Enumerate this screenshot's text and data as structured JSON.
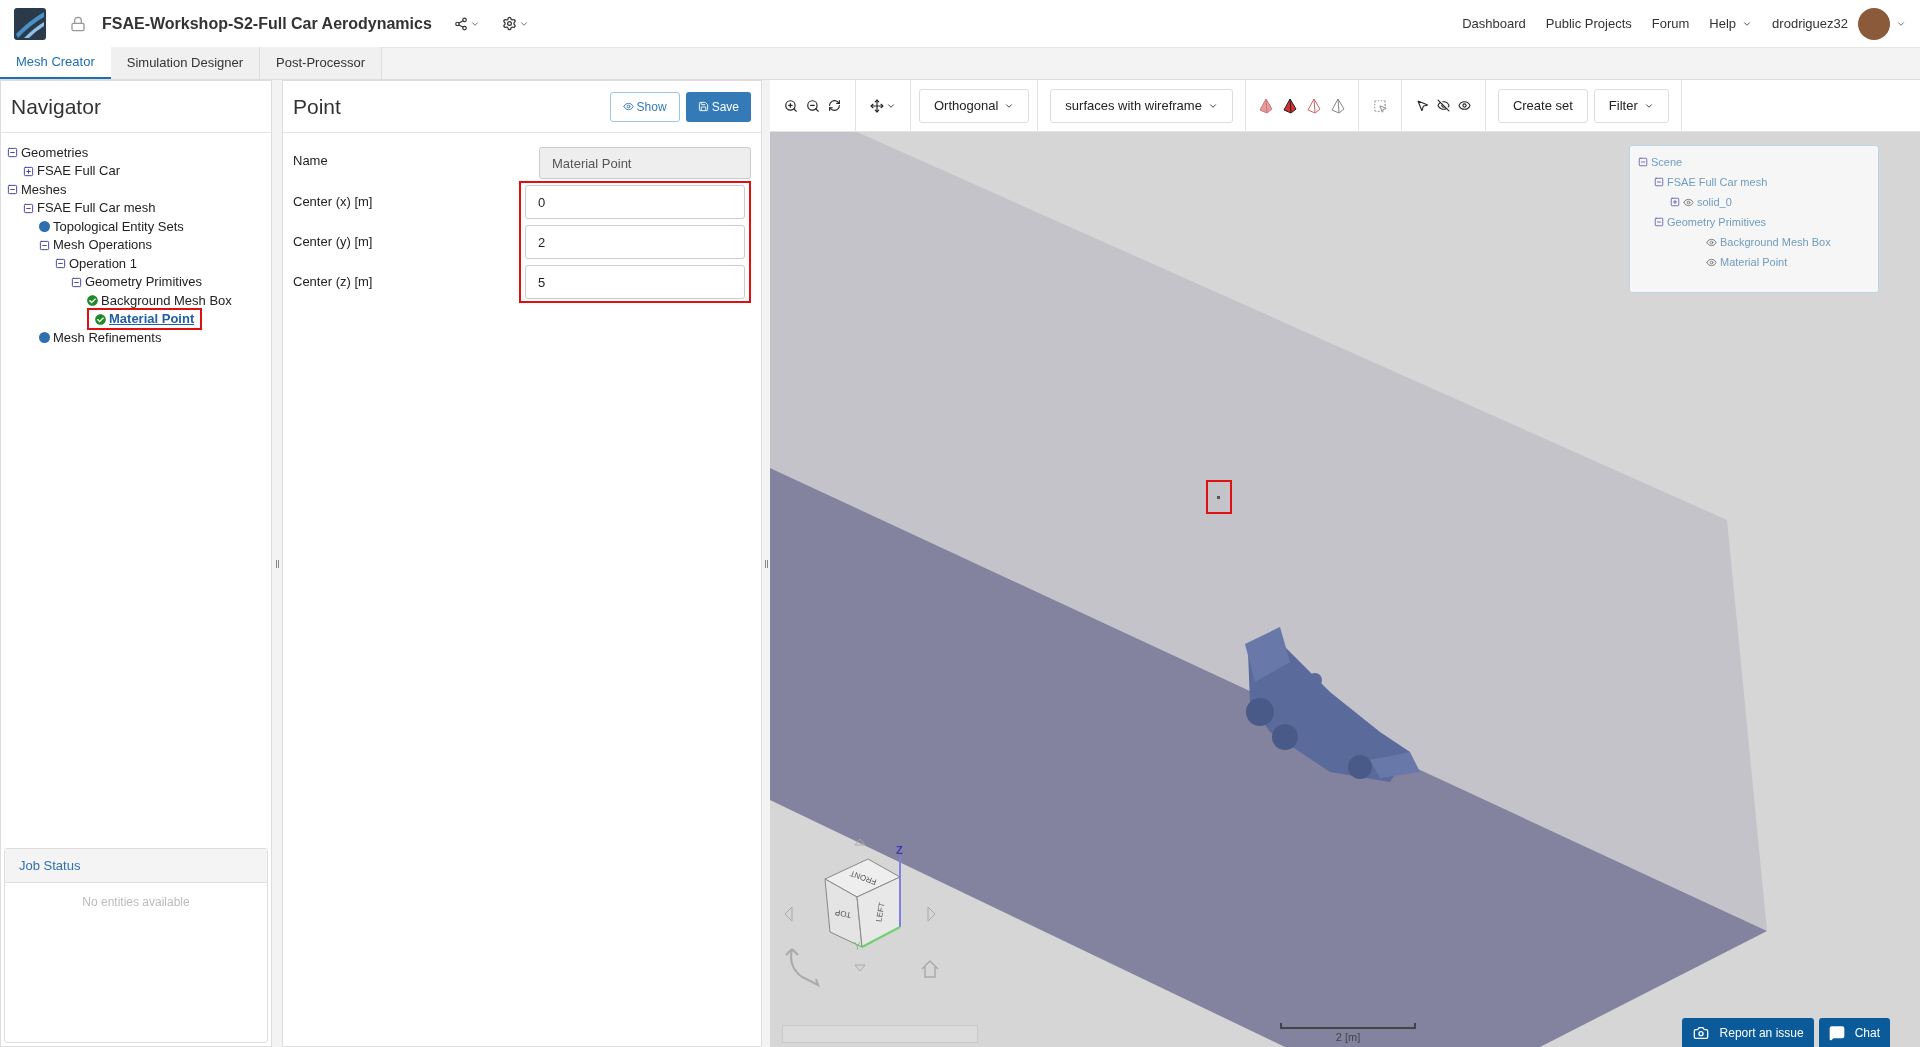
{
  "app": {
    "title": "FSAE-Workshop-S2-Full Car Aerodynamics",
    "nav_links": [
      {
        "label": "Dashboard",
        "dropdown": false
      },
      {
        "label": "Public Projects",
        "dropdown": false
      },
      {
        "label": "Forum",
        "dropdown": false
      },
      {
        "label": "Help",
        "dropdown": true
      }
    ],
    "username": "drodriguez32"
  },
  "tabs": [
    {
      "label": "Mesh Creator",
      "selected": true
    },
    {
      "label": "Simulation Designer",
      "selected": false
    },
    {
      "label": "Post-Processor",
      "selected": false
    }
  ],
  "navigator": {
    "title": "Navigator",
    "tree": [
      {
        "label": "Geometries",
        "kind": "group",
        "expanded": true,
        "selected": false,
        "children": [
          {
            "label": "FSAE Full Car",
            "kind": "group",
            "expanded": false,
            "selected": false
          }
        ]
      },
      {
        "label": "Meshes",
        "kind": "group",
        "expanded": true,
        "selected": false,
        "children": [
          {
            "label": "FSAE Full Car mesh",
            "kind": "group",
            "expanded": true,
            "selected": false,
            "children": [
              {
                "label": "Topological Entity Sets",
                "kind": "dot",
                "selected": false
              },
              {
                "label": "Mesh Operations",
                "kind": "group",
                "expanded": true,
                "selected": false,
                "children": [
                  {
                    "label": "Operation 1",
                    "kind": "group",
                    "expanded": true,
                    "selected": false,
                    "children": [
                      {
                        "label": "Geometry Primitives",
                        "kind": "group",
                        "expanded": true,
                        "selected": false,
                        "children": [
                          {
                            "label": "Background Mesh Box",
                            "kind": "check",
                            "selected": false
                          },
                          {
                            "label": "Material Point",
                            "kind": "check",
                            "selected": true
                          }
                        ]
                      }
                    ]
                  }
                ]
              },
              {
                "label": "Mesh Refinements",
                "kind": "dot",
                "selected": false
              }
            ]
          }
        ]
      }
    ]
  },
  "job_status": {
    "title": "Job Status",
    "empty_text": "No entities available"
  },
  "point_panel": {
    "title": "Point",
    "buttons": [
      {
        "label": "Show",
        "kind": "secondary"
      },
      {
        "label": "Save",
        "kind": "primary"
      }
    ],
    "name_field": {
      "label": "Name",
      "value": "Material Point",
      "disabled": true
    },
    "center_group": {
      "highlighted": true,
      "fields": [
        {
          "label": "Center (x) [m]",
          "value": "0"
        },
        {
          "label": "Center (y) [m]",
          "value": "2"
        },
        {
          "label": "Center (z) [m]",
          "value": "5"
        }
      ]
    }
  },
  "toolbar": {
    "projection": "Orthogonal",
    "render_mode": "surfaces with wireframe",
    "buttons": [
      {
        "label": "Create set",
        "dropdown": false
      },
      {
        "label": "Filter",
        "dropdown": true
      }
    ]
  },
  "scene_tree": [
    {
      "label": "Scene",
      "expanded": true,
      "eye": false,
      "children": [
        {
          "label": "FSAE Full Car mesh",
          "expanded": true,
          "eye": false,
          "children": [
            {
              "label": "solid_0",
              "expanded": false,
              "eye": true
            }
          ]
        },
        {
          "label": "Geometry Primitives",
          "expanded": true,
          "eye": false,
          "children": [
            {
              "label": "Background Mesh Box",
              "eye": true
            },
            {
              "label": "Material Point",
              "eye": true
            }
          ]
        }
      ]
    }
  ],
  "viewport": {
    "point_highlighted": true,
    "cube_labels": {
      "front": "FRONT",
      "top": "TOP",
      "left": "LEFT",
      "y_axis": "Y",
      "z_axis": "Z"
    },
    "scale_label": "2 [m]"
  },
  "footer_buttons": [
    {
      "label": "Report an issue",
      "kind": "report"
    },
    {
      "label": "Chat",
      "kind": "chat"
    }
  ]
}
